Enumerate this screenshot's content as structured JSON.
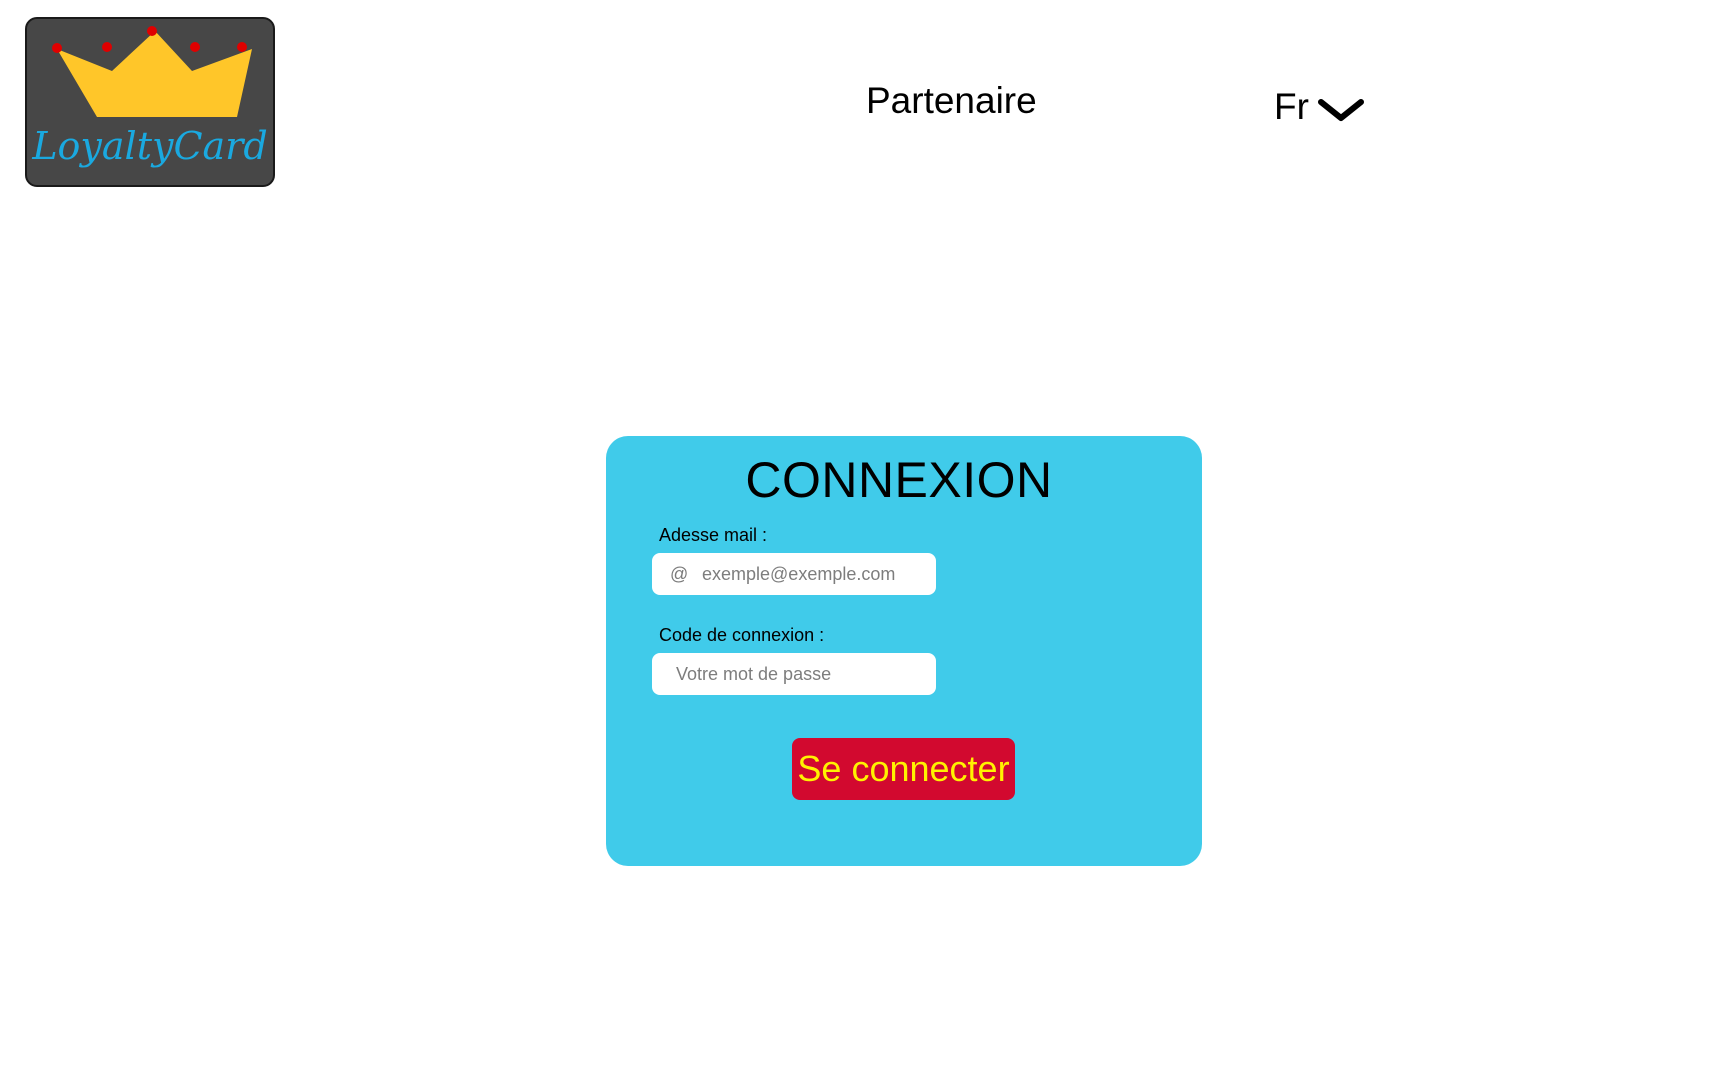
{
  "header": {
    "logo": {
      "text": "LoyaltyCard",
      "icon": "crown-icon",
      "background_color": "#474747",
      "crown_color": "#ffc629",
      "jewel_color": "#e00000",
      "text_color": "#1aa9e0"
    },
    "nav_partner_label": "Partenaire",
    "language": {
      "selected": "Fr",
      "icon": "chevron-down-icon"
    }
  },
  "login": {
    "title": "CONNEXION",
    "email_label": "Adesse mail :",
    "email_icon": "@",
    "email_placeholder": "exemple@exemple.com",
    "email_value": "",
    "code_label": "Code de connexion :",
    "code_placeholder": "Votre mot de passe",
    "code_value": "",
    "submit_label": "Se connecter",
    "card_color": "#40cbea",
    "button_color": "#d2092f",
    "button_text_color": "#fff200"
  }
}
